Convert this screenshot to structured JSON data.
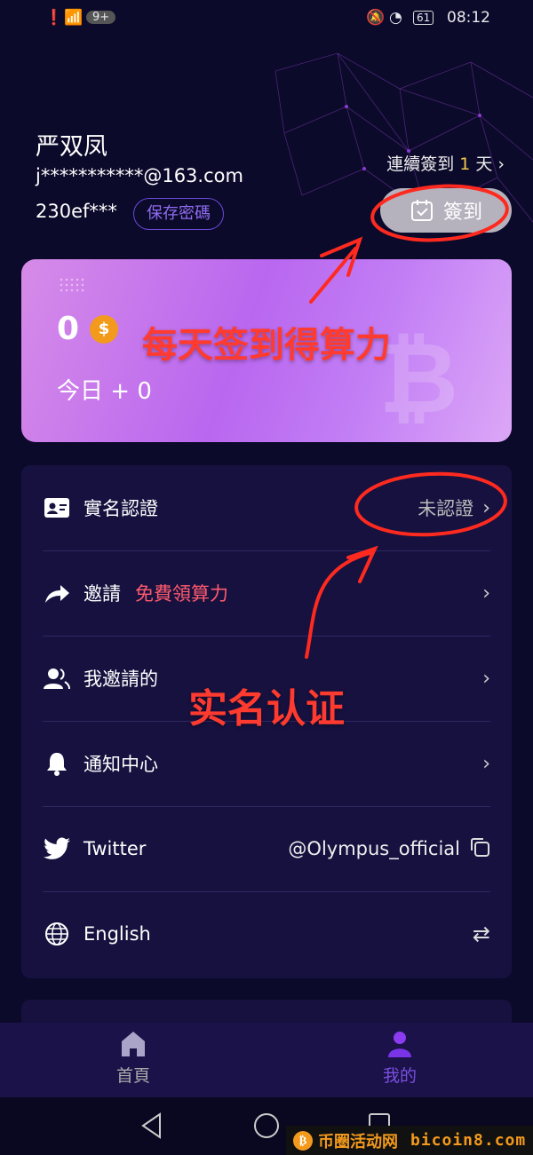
{
  "status": {
    "badge": "9+",
    "battery": "61",
    "time": "08:12"
  },
  "profile": {
    "name": "严双凤",
    "email": "j***********@163.com",
    "uid": "230ef***",
    "save_password": "保存密碼"
  },
  "checkin": {
    "streak_prefix": "連續簽到",
    "streak_days": "1",
    "streak_suffix": "天",
    "button": "簽到"
  },
  "card": {
    "balance": "0",
    "coin_symbol": "$",
    "today": "今日 + 0"
  },
  "menu": [
    {
      "icon": "id-card-icon",
      "label": "實名認證",
      "value": "未認證"
    },
    {
      "icon": "share-icon",
      "label": "邀請",
      "promo": "免費領算力"
    },
    {
      "icon": "users-icon",
      "label": "我邀請的"
    },
    {
      "icon": "bell-icon",
      "label": "通知中心"
    },
    {
      "icon": "twitter-icon",
      "label": "Twitter",
      "value": "@Olympus_official"
    },
    {
      "icon": "globe-icon",
      "label": "English"
    }
  ],
  "nav": {
    "home": "首頁",
    "mine": "我的",
    "active": "mine",
    "active_color": "#8b3cf0"
  },
  "annotations": {
    "checkin_note": "每天签到得算力",
    "verify_note": "实名认证"
  },
  "watermark": {
    "site_cn": "币圈活动网",
    "site": "bicoin8.com"
  }
}
